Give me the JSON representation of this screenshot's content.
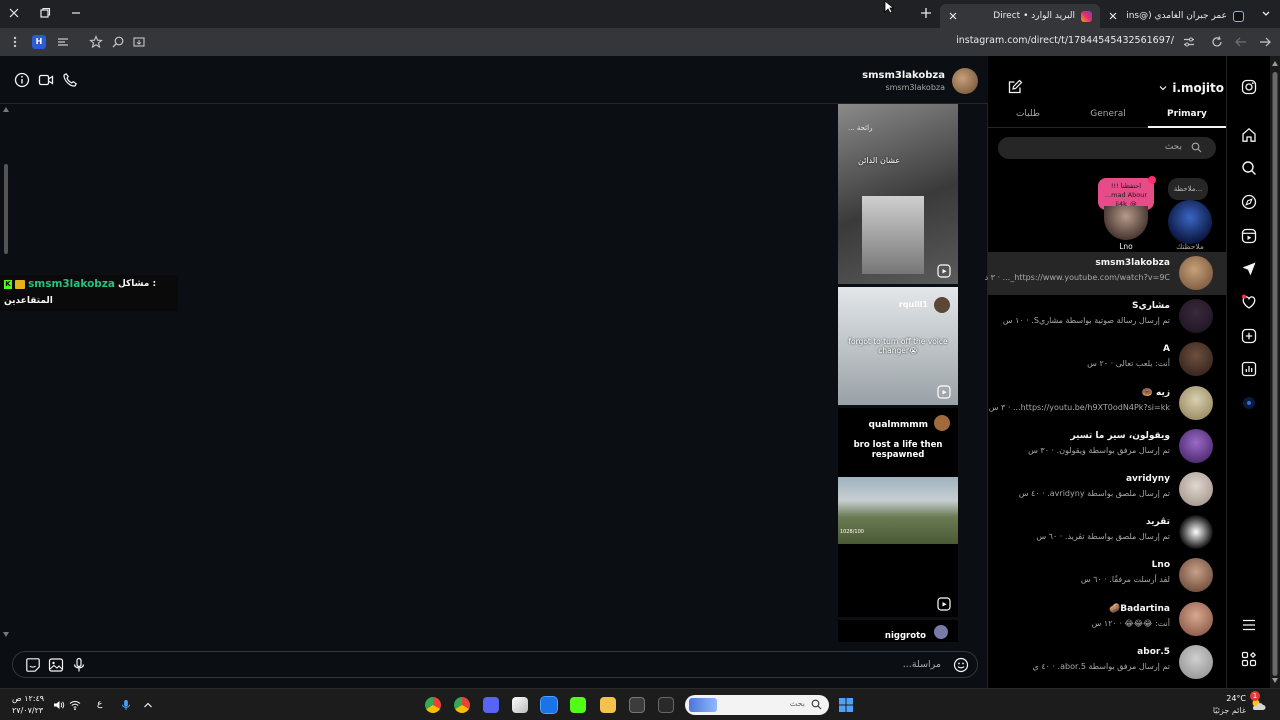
{
  "browser": {
    "tabs": [
      {
        "title": "عمر جبران الغامدي (@explains..."
      },
      {
        "title": "البريد الوارد • Direct"
      }
    ],
    "url": "instagram.com/direct/t/17844545432561697/"
  },
  "chat": {
    "header": {
      "name": "smsm3lakobza",
      "username": "smsm3lakobza"
    },
    "overlay": {
      "user": "smsm3lakobza",
      "label": ": مشاكل",
      "line2": "المتقاعدين"
    },
    "reels": [
      {
        "caption_top": "رائحة ...",
        "caption": "عشان الدائن"
      },
      {
        "user": "rquill1",
        "caption": "forgot to turn off the voice changer😭"
      },
      {
        "user": "qualmmmm",
        "caption": "bro lost a life then respawned",
        "counter": "1028/100"
      },
      {
        "user": "niggroto"
      }
    ],
    "composer_placeholder": "مراسلة..."
  },
  "inbox": {
    "account": "i.mojito",
    "tabs": [
      "Primary",
      "General",
      "طلبات"
    ],
    "active_tab": "Primary",
    "search_placeholder": "بحث",
    "notes": [
      {
        "name": "ملاحظتك",
        "bubble": "ملاحظة..."
      },
      {
        "name": "Lno",
        "bubble": "!!! احتفظنا ...mad Abour ji4k_@"
      }
    ],
    "threads": [
      {
        "name": "smsm3lakobza",
        "preview": "https://www.youtube.com/watch?v=9C_... · ٣ د"
      },
      {
        "name": "مشاريS",
        "preview": "تم إرسال رسالة صوتية بواسطة مشاريS. · ١٠ س"
      },
      {
        "name": "A",
        "preview": "أنت: يلعب تعالى · ٢٠ س"
      },
      {
        "name": "زيه 🍩",
        "preview": "https://youtu.be/h9XT0odN4Pk?si=kk... · ٣ س"
      },
      {
        "name": "ويقولون، سير ما تسير",
        "preview": "تم إرسال مرفق بواسطة ويقولون. · ٣٠ س"
      },
      {
        "name": "avridyny",
        "preview": "تم إرسال ملصق بواسطة avridyny. · ٤٠ س"
      },
      {
        "name": "تڤريد",
        "preview": "تم إرسال ملصق بواسطة تڤريد. · ٦٠ س"
      },
      {
        "name": "Lno",
        "preview": "لقد أرسلت مرفقًا. · ٦٠ س"
      },
      {
        "name": "Badartina🥔",
        "preview": "أنت: 😂😂😂 · ١٢٠ س"
      },
      {
        "name": "5.abor",
        "preview": "تم إرسال مرفق بواسطة 5.abor. · ٤٠ ي"
      }
    ]
  },
  "taskbar": {
    "time": "١٢:٤٩ ص",
    "date": "٢٧/٠٧/٢٣",
    "lang": "ع",
    "search_placeholder": "بحث",
    "weather_temp": "24°C",
    "weather_text": "غائم جزئيًا",
    "notification_count": "1"
  },
  "colors": {
    "accent": "#0095f6",
    "bg": "#000000",
    "chat_bg": "#0b0f14",
    "selected_row": "#262626",
    "note_bubble": "#e84c88",
    "overlay_green": "#26c281"
  }
}
